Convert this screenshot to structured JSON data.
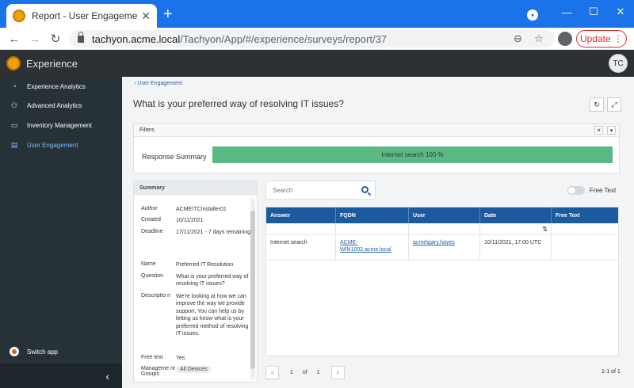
{
  "browser": {
    "tab_title": "Report - User Engagement - Expe",
    "url_host": "tachyon.acme.local",
    "url_path": "/Tachyon/App/#/experience/surveys/report/37",
    "update_label": "Update"
  },
  "app": {
    "name": "Experience",
    "user_initials": "TC"
  },
  "sidebar": {
    "items": [
      {
        "label": "Experience Analytics",
        "icon": "gauge-icon"
      },
      {
        "label": "Advanced Analytics",
        "icon": "binoculars-icon"
      },
      {
        "label": "Inventory Management",
        "icon": "monitor-icon"
      },
      {
        "label": "User Engagement",
        "icon": "clipboard-icon",
        "active": true
      }
    ],
    "switch_app": "Switch app"
  },
  "main": {
    "breadcrumb": "User Engagement",
    "title": "What is your preferred way of resolving IT issues?",
    "filters_label": "Filters",
    "response_summary_label": "Response Summary",
    "response_bar_text": "Internet search 100 %",
    "response_bar_share": 1.0
  },
  "summary": {
    "header": "Summary",
    "author_k": "Author",
    "author_v": "ACME\\TCInstaller01",
    "created_k": "Created",
    "created_v": "10/11/2021",
    "deadline_k": "Deadline",
    "deadline_v": "17/11/2021 - 7 days remaining",
    "name_k": "Name",
    "name_v": "Preferred IT Resolution",
    "question_k": "Question",
    "question_v": "What is your preferred way of resolving IT issues?",
    "description_k": "Descriptio n",
    "description_v": "We're looking at how we can improve the way we provide support. You can help us by letting us know what is your preferred method of resolving IT issues.",
    "freetext_k": "Free text",
    "freetext_v": "Yes",
    "mgmt_k": "Manageme nt Groups",
    "mgmt_v": "All Devices"
  },
  "search": {
    "placeholder": "Search"
  },
  "free_text_toggle": {
    "label": "Free Text",
    "on": false
  },
  "table": {
    "columns": [
      "Answer",
      "FQDN",
      "User",
      "Date",
      "Free Text"
    ],
    "rows": [
      {
        "answer": "Internet search",
        "fqdn": "ACME-WIN1002.acme.local",
        "user": "acme\\gary.hayes",
        "date": "10/11/2021, 17:00 UTC",
        "free_text": ""
      }
    ]
  },
  "pager": {
    "page": "1",
    "of": "of",
    "total_pages": "1",
    "row_count": "1-1 of 1"
  }
}
